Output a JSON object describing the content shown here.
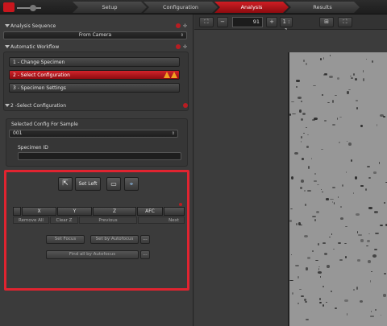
{
  "header": {
    "tabs": [
      {
        "label": "Setup",
        "active": false
      },
      {
        "label": "Configuration",
        "active": false
      },
      {
        "label": "Analysis",
        "active": true
      },
      {
        "label": "Results",
        "active": false
      }
    ]
  },
  "sidebar": {
    "analysis_sequence": {
      "title": "Analysis Sequence",
      "source_value": "From Camera"
    },
    "automatic_workflow": {
      "title": "Automatic Workflow",
      "steps": [
        {
          "label": "1 - Change Specimen",
          "active": false
        },
        {
          "label": "2 - Select Configuration",
          "active": true
        },
        {
          "label": "3 - Specimen Settings",
          "active": false
        }
      ]
    },
    "select_configuration": {
      "title": "2 -Select Configuration",
      "config_label": "Selected Config For Sample",
      "config_value": "001",
      "specimen_id_label": "Specimen ID",
      "specimen_id_value": ""
    },
    "stage_control": {
      "set_left_label": "Set Left",
      "axes": [
        "X",
        "Y",
        "Z",
        "AFC"
      ],
      "actions": [
        "Remove All",
        "Clear Z",
        "Previous",
        "Next"
      ],
      "set_focus_label": "Set Focus",
      "set_by_autofocus_label": "Set by Autofocus",
      "find_all_label": "Find all by Autofocus",
      "more_label": "..."
    }
  },
  "viewer_toolbar": {
    "zoom_value": "91",
    "minus_label": "−",
    "plus_label": "+",
    "ratio_label": "1 : 1"
  },
  "colors": {
    "accent": "#c8161d",
    "highlight_outline": "#e02430",
    "warning": "#f0a020"
  }
}
